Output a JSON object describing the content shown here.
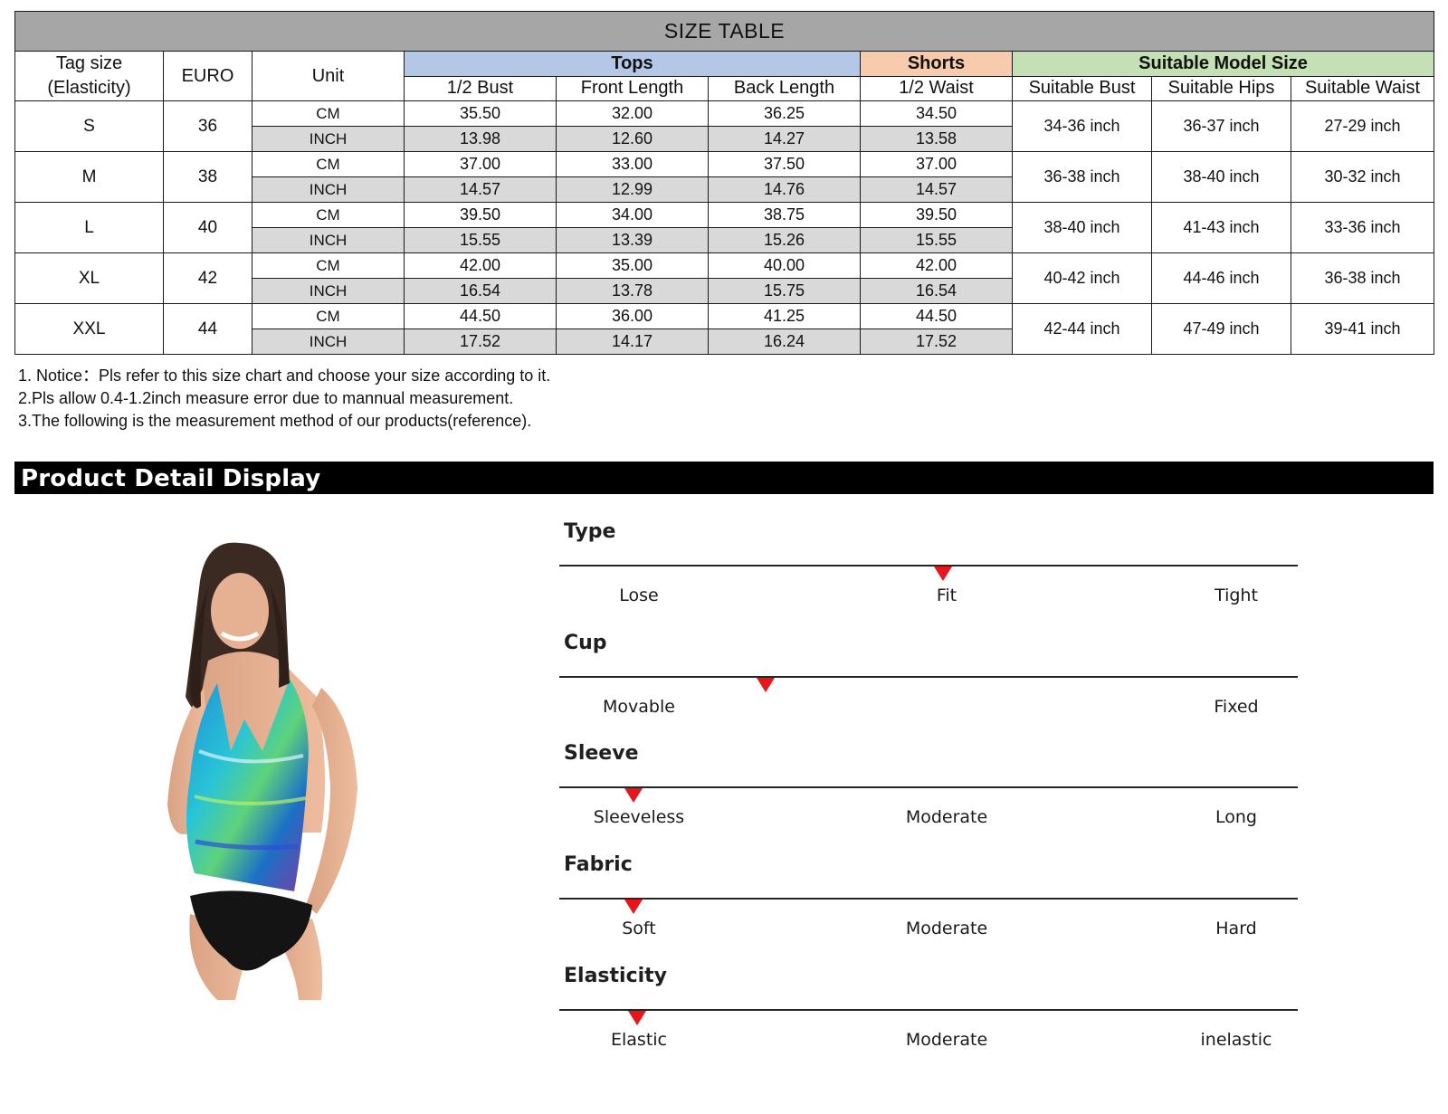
{
  "size_table": {
    "title": "SIZE TABLE",
    "headers": {
      "tag_size": [
        "Tag size",
        "(Elasticity)"
      ],
      "euro": "EURO",
      "unit": "Unit",
      "tops": "Tops",
      "shorts": "Shorts",
      "model": "Suitable Model Size",
      "bust": "1/2 Bust",
      "front_length": "Front Length",
      "back_length": "Back Length",
      "waist": "1/2 Waist",
      "suitable_bust": "Suitable Bust",
      "suitable_hips": "Suitable Hips",
      "suitable_waist": "Suitable Waist"
    },
    "rows": [
      {
        "size": "S",
        "euro": "36",
        "cm": {
          "unit": "CM",
          "bust": "35.50",
          "front": "32.00",
          "back": "36.25",
          "waist": "34.50"
        },
        "inch": {
          "unit": "INCH",
          "bust": "13.98",
          "front": "12.60",
          "back": "14.27",
          "waist": "13.58"
        },
        "model_bust": "34-36 inch",
        "model_hips": "36-37 inch",
        "model_waist": "27-29 inch"
      },
      {
        "size": "M",
        "euro": "38",
        "cm": {
          "unit": "CM",
          "bust": "37.00",
          "front": "33.00",
          "back": "37.50",
          "waist": "37.00"
        },
        "inch": {
          "unit": "INCH",
          "bust": "14.57",
          "front": "12.99",
          "back": "14.76",
          "waist": "14.57"
        },
        "model_bust": "36-38 inch",
        "model_hips": "38-40 inch",
        "model_waist": "30-32 inch"
      },
      {
        "size": "L",
        "euro": "40",
        "cm": {
          "unit": "CM",
          "bust": "39.50",
          "front": "34.00",
          "back": "38.75",
          "waist": "39.50"
        },
        "inch": {
          "unit": "INCH",
          "bust": "15.55",
          "front": "13.39",
          "back": "15.26",
          "waist": "15.55"
        },
        "model_bust": "38-40 inch",
        "model_hips": "41-43 inch",
        "model_waist": "33-36 inch"
      },
      {
        "size": "XL",
        "euro": "42",
        "cm": {
          "unit": "CM",
          "bust": "42.00",
          "front": "35.00",
          "back": "40.00",
          "waist": "42.00"
        },
        "inch": {
          "unit": "INCH",
          "bust": "16.54",
          "front": "13.78",
          "back": "15.75",
          "waist": "16.54"
        },
        "model_bust": "40-42 inch",
        "model_hips": "44-46 inch",
        "model_waist": "36-38 inch"
      },
      {
        "size": "XXL",
        "euro": "44",
        "cm": {
          "unit": "CM",
          "bust": "44.50",
          "front": "36.00",
          "back": "41.25",
          "waist": "44.50"
        },
        "inch": {
          "unit": "INCH",
          "bust": "17.52",
          "front": "14.17",
          "back": "16.24",
          "waist": "17.52"
        },
        "model_bust": "42-44 inch",
        "model_hips": "47-49 inch",
        "model_waist": "39-41 inch"
      }
    ]
  },
  "notes": [
    "1. Notice：Pls refer to this size chart and choose your size according to it.",
    "2.Pls allow 0.4-1.2inch measure error due to mannual measurement.",
    "3.The following is the measurement method of our products(reference)."
  ],
  "detail": {
    "banner": "Product Detail Display",
    "attributes": [
      {
        "name": "Type",
        "labels": [
          "Lose",
          "Fit",
          "Tight"
        ],
        "level": 0.52
      },
      {
        "name": "Cup",
        "labels": [
          "Movable",
          "",
          "Fixed"
        ],
        "level": 0.28
      },
      {
        "name": "Sleeve",
        "labels": [
          "Sleeveless",
          "Moderate",
          "Long"
        ],
        "level": 0.1
      },
      {
        "name": "Fabric",
        "labels": [
          "Soft",
          "Moderate",
          "Hard"
        ],
        "level": 0.1
      },
      {
        "name": "Elasticity",
        "labels": [
          "Elastic",
          "Moderate",
          "inelastic"
        ],
        "level": 0.105
      }
    ]
  },
  "colors": {
    "title_bar": "#a6a6a6",
    "tops_header": "#b4c7e7",
    "shorts_header": "#f8cbad",
    "model_header": "#c5e0b4",
    "inch_row": "#d9d9d9",
    "marker": "#e8151b"
  }
}
